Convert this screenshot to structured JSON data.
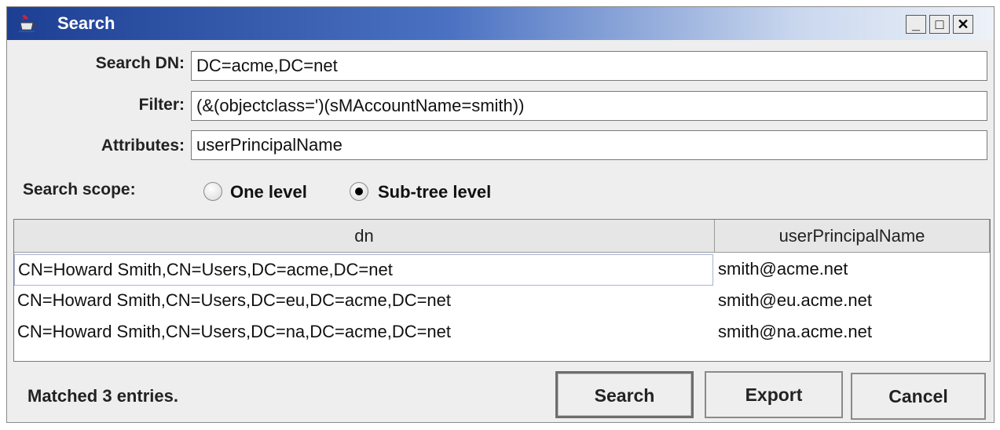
{
  "window": {
    "title": "Search",
    "controls": {
      "minimize": "_",
      "maximize": "□",
      "close": "✕"
    },
    "icon": "java-cup-icon"
  },
  "form": {
    "search_dn": {
      "label": "Search DN:",
      "value": "DC=acme,DC=net"
    },
    "filter": {
      "label": "Filter:",
      "value": "(&(objectclass=')(sMAccountName=smith))"
    },
    "attributes": {
      "label": "Attributes:",
      "value": "userPrincipalName"
    },
    "scope": {
      "label": "Search scope:",
      "options": [
        {
          "label": "One level",
          "selected": false
        },
        {
          "label": "Sub-tree level",
          "selected": true
        }
      ]
    }
  },
  "table": {
    "columns": [
      "dn",
      "userPrincipalName"
    ],
    "rows": [
      [
        "CN=Howard Smith,CN=Users,DC=acme,DC=net",
        "smith@acme.net"
      ],
      [
        "CN=Howard Smith,CN=Users,DC=eu,DC=acme,DC=net",
        "smith@eu.acme.net"
      ],
      [
        "CN=Howard Smith,CN=Users,DC=na,DC=acme,DC=net",
        "smith@na.acme.net"
      ]
    ]
  },
  "footer": {
    "status": "Matched 3 entries.",
    "buttons": {
      "search": "Search",
      "export": "Export",
      "cancel": "Cancel"
    }
  }
}
